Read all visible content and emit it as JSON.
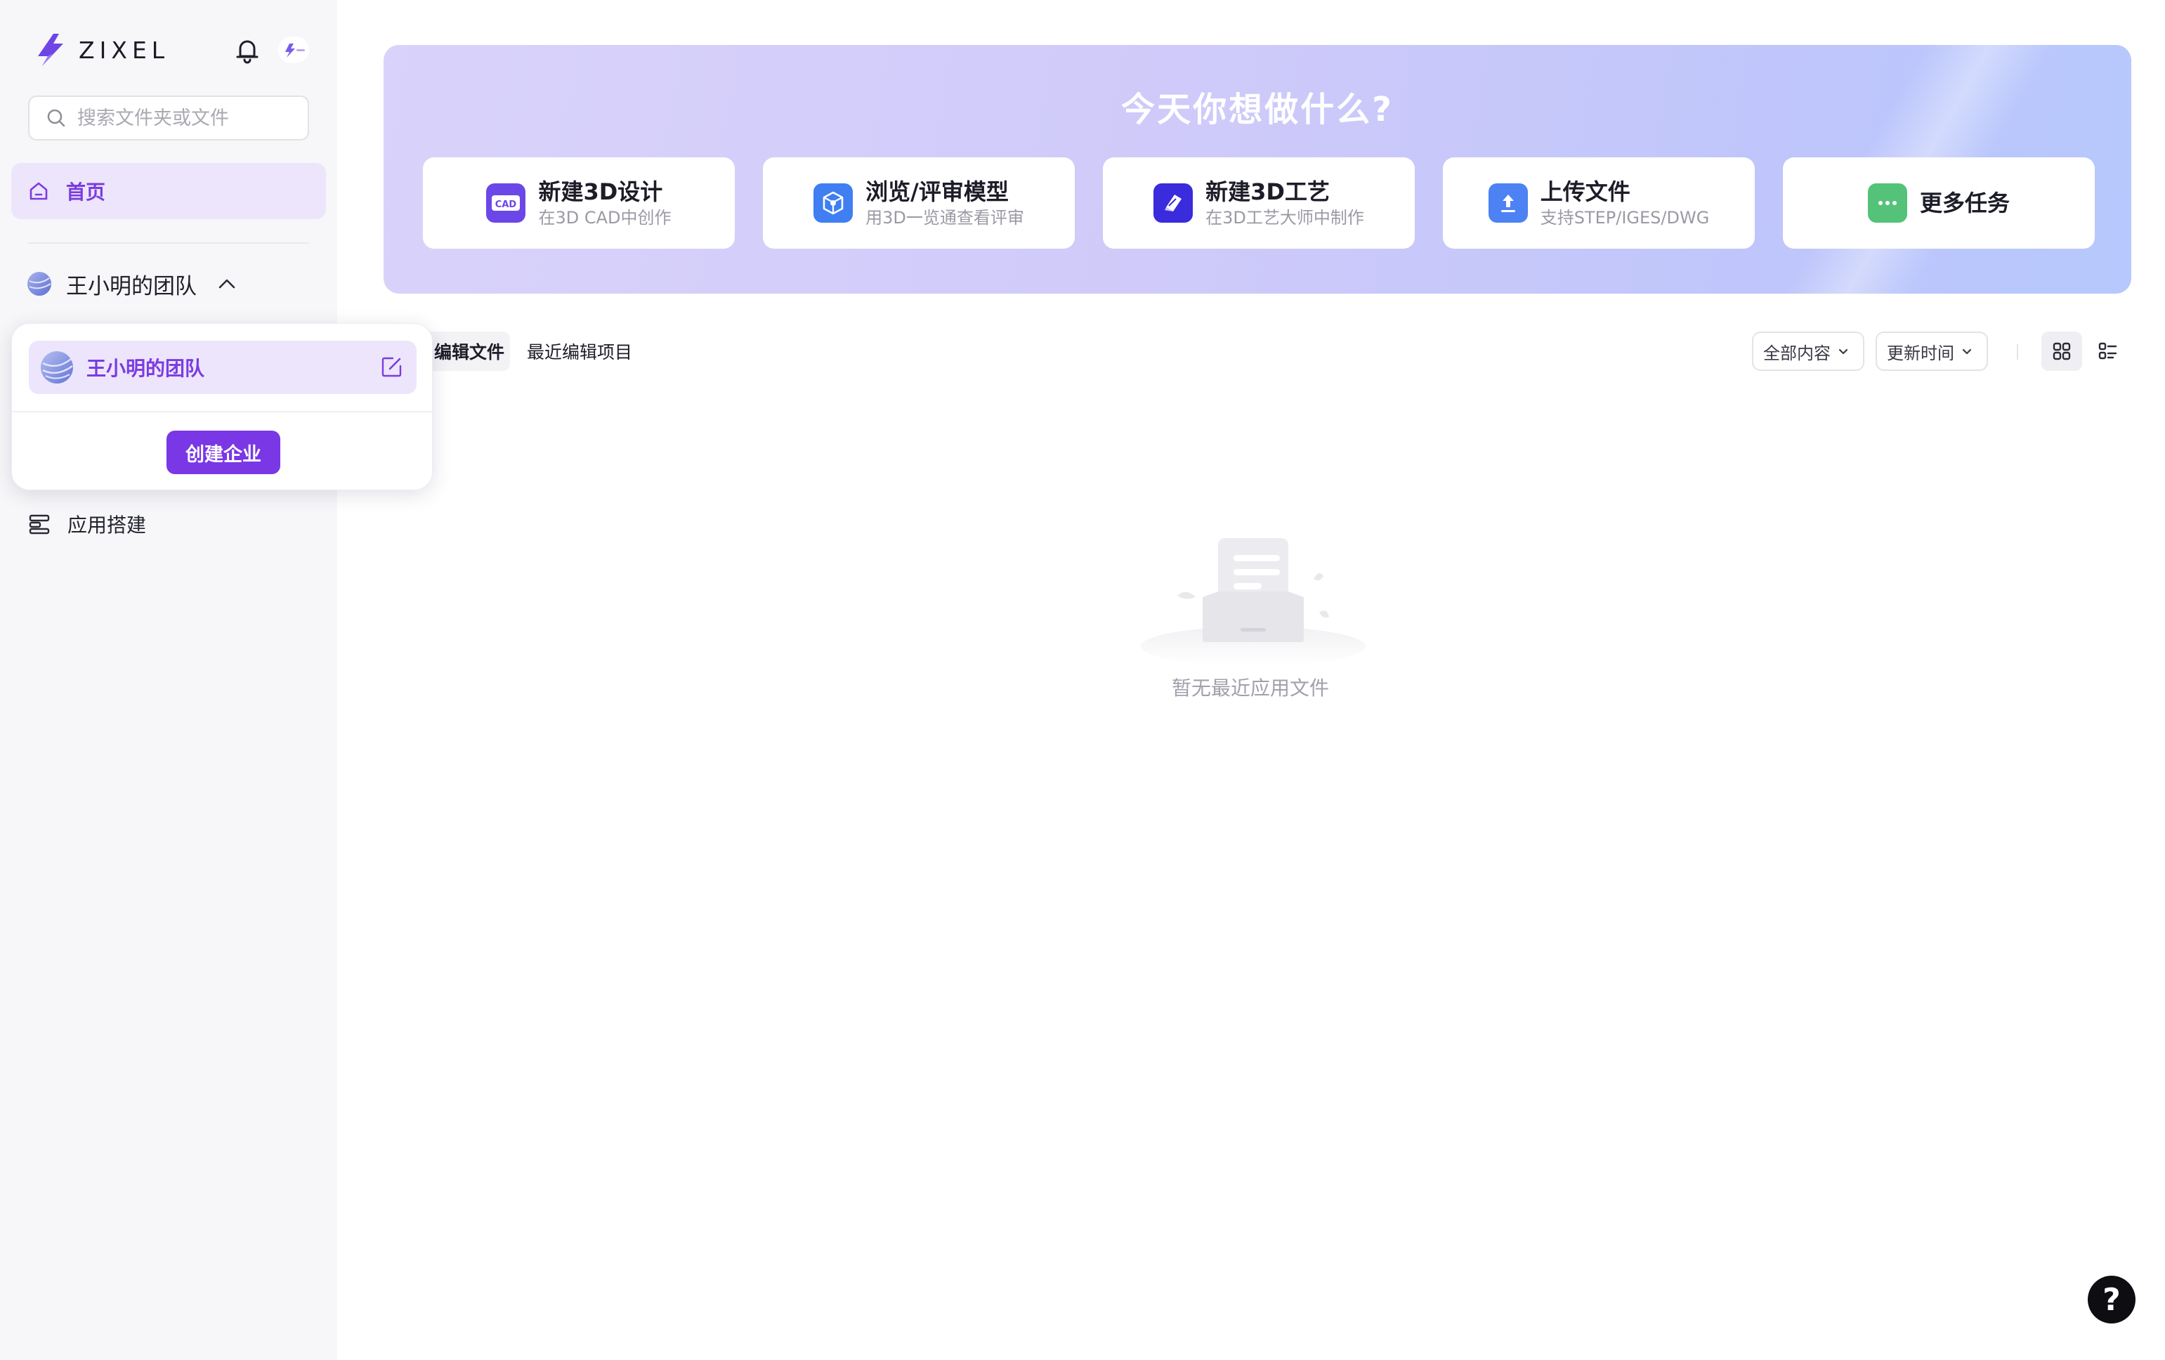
{
  "brand": {
    "name": "ZIXEL",
    "accent": "#7a37e6"
  },
  "sidebar": {
    "search_placeholder": "搜索文件夹或文件",
    "home_label": "首页",
    "team_label": "王小明的团队",
    "app_label": "应用搭建",
    "icons": [
      "bell-icon",
      "home-icon",
      "chevron-up-icon",
      "app-builder-icon",
      "search-icon"
    ]
  },
  "team_popover": {
    "team_name": "王小明的团队",
    "create_button": "创建企业"
  },
  "banner": {
    "title": "今天你想做什么?",
    "cards": [
      {
        "title": "新建3D设计",
        "subtitle": "在3D CAD中创作",
        "icon_text": "CAD",
        "icon_color": "#6c47e8"
      },
      {
        "title": "浏览/评审模型",
        "subtitle": "用3D一览通查看评审",
        "icon_color": "#3f7ff2"
      },
      {
        "title": "新建3D工艺",
        "subtitle": "在3D工艺大师中制作",
        "icon_color": "#3a2bdc"
      },
      {
        "title": "上传文件",
        "subtitle": "支持STEP/IGES/DWG",
        "icon_color": "#4c82f3"
      },
      {
        "title": "更多任务",
        "icon_color": "#55c27a"
      }
    ]
  },
  "toolbar": {
    "tab_active": "编辑文件",
    "tab_projects": "最近编辑项目",
    "filter_all": "全部内容",
    "sort_time": "更新时间"
  },
  "empty_state": {
    "text": "暂无最近应用文件"
  },
  "help": {
    "label": "?"
  }
}
